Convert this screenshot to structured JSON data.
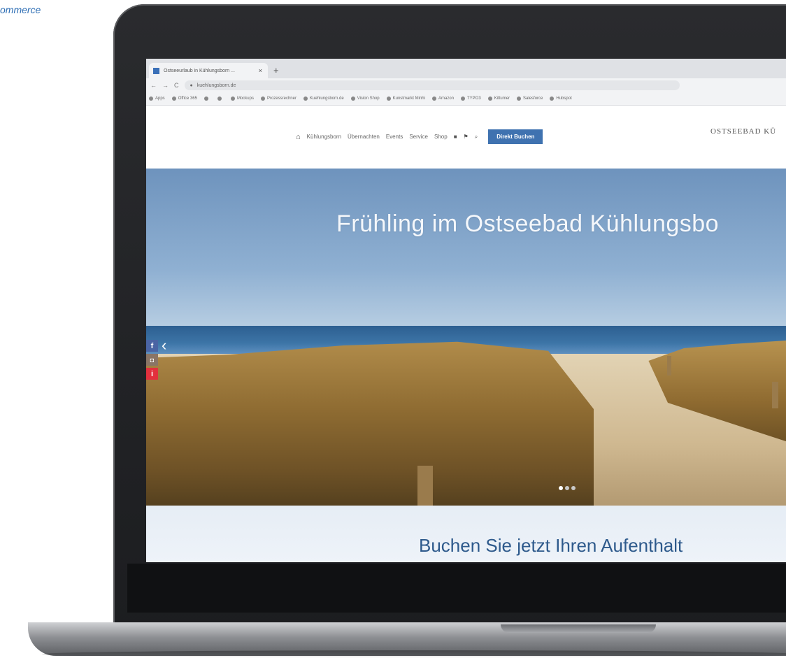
{
  "corner_text": "ommerce",
  "browser": {
    "tab_title": "Ostseeurlaub in Kühlungsborn ...",
    "tab_close": "×",
    "new_tab": "+",
    "url": "kuehlungsborn.de",
    "bookmarks": [
      "Apps",
      "Office 365",
      "",
      "",
      "Mockups",
      "Prozessrechner",
      "Kuehlungsborn.de",
      "Vision Shop",
      "Kunstmarkt Minhi",
      "Amazon",
      "TYPO3",
      "Kittumer",
      "Salesforce",
      "Hubspot"
    ]
  },
  "site": {
    "nav": {
      "items": [
        "Kühlungsborn",
        "Übernachten",
        "Events",
        "Service",
        "Shop"
      ],
      "cta": "Direkt Buchen"
    },
    "brand": "OSTSEEBAD KÜ",
    "hero": {
      "title": "Frühling im Ostseebad Kühlungsbo",
      "slide_count": 3,
      "active_slide": 1
    },
    "booking_title": "Buchen Sie jetzt Ihren Aufenthalt"
  },
  "colors": {
    "accent": "#3f72b0",
    "facebook": "#4a64a4",
    "info": "#e2303d"
  }
}
